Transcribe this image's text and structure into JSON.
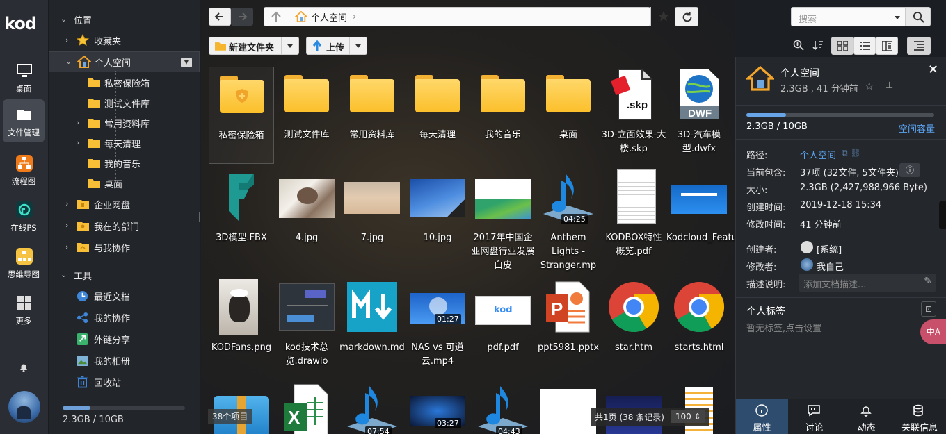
{
  "app": {
    "logo": "kod",
    "apps": [
      {
        "label": "桌面",
        "icon": "monitor-icon"
      },
      {
        "label": "文件管理",
        "icon": "folder-manage-icon"
      },
      {
        "label": "流程图",
        "icon": "flowchart-icon"
      },
      {
        "label": "在线PS",
        "icon": "photoshop-icon"
      },
      {
        "label": "思维导图",
        "icon": "mindmap-icon"
      },
      {
        "label": "更多",
        "icon": "grid-icon"
      }
    ]
  },
  "sidebar": {
    "section_location": "位置",
    "favorites": "收藏夹",
    "personal_space": "个人空间",
    "subfolders": [
      "私密保险箱",
      "测试文件库",
      "常用资料库",
      "每天清理",
      "我的音乐",
      "桌面"
    ],
    "enterprise_disk": "企业网盘",
    "my_department": "我在的部门",
    "collab_with_me": "与我协作",
    "section_tools": "工具",
    "tools": [
      "最近文档",
      "我的协作",
      "外链分享",
      "我的相册",
      "回收站"
    ],
    "quota_text": "2.3GB / 10GB",
    "quota_used": 0.23
  },
  "toolbar": {
    "breadcrumb": "个人空间",
    "search_placeholder": "搜索",
    "new_folder": "新建文件夹",
    "upload": "上传"
  },
  "files": [
    {
      "name": "私密保险箱",
      "type": "safe"
    },
    {
      "name": "测试文件库",
      "type": "folder"
    },
    {
      "name": "常用资料库",
      "type": "folder"
    },
    {
      "name": "每天清理",
      "type": "folder"
    },
    {
      "name": "我的音乐",
      "type": "folder"
    },
    {
      "name": "桌面",
      "type": "folder"
    },
    {
      "name": "3D-立面效果-大楼.skp",
      "type": "skp"
    },
    {
      "name": "3D-汽车模型.dwfx",
      "type": "dwf"
    },
    {
      "name": "3D模型.FBX",
      "type": "fbx"
    },
    {
      "name": "4.jpg",
      "type": "img-cat"
    },
    {
      "name": "7.jpg",
      "type": "img-beach"
    },
    {
      "name": "10.jpg",
      "type": "img-sky"
    },
    {
      "name": "2017年中国企业网盘行业发展白皮",
      "type": "img-report"
    },
    {
      "name": "Anthem Lights - Stranger.mp",
      "type": "music",
      "duration": "04:25"
    },
    {
      "name": "KODBOX特性概览.pdf",
      "type": "doc"
    },
    {
      "name": "Kodcloud_FeaturesOverview_en.pdf",
      "type": "img-web"
    },
    {
      "name": "KODFans.png",
      "type": "img-person"
    },
    {
      "name": "kod技术总览.drawio",
      "type": "img-drawio"
    },
    {
      "name": "markdown.md",
      "type": "md"
    },
    {
      "name": "NAS vs 可道云.mp4",
      "type": "video",
      "duration": "01:27"
    },
    {
      "name": "pdf.pdf",
      "type": "img-kod"
    },
    {
      "name": "ppt5981.pptx",
      "type": "ppt"
    },
    {
      "name": "star.htm",
      "type": "chrome"
    },
    {
      "name": "starts.html",
      "type": "chrome"
    },
    {
      "name": "",
      "type": "zip"
    },
    {
      "name": "",
      "type": "excel"
    },
    {
      "name": "",
      "type": "music",
      "duration": "07:54"
    },
    {
      "name": "",
      "type": "video2",
      "duration": "03:27"
    },
    {
      "name": "",
      "type": "music",
      "duration": "04:43"
    },
    {
      "name": "",
      "type": "img-white"
    },
    {
      "name": "",
      "type": "img-dark"
    },
    {
      "name": "",
      "type": "img-list"
    }
  ],
  "status": {
    "item_count": "38个项目",
    "pagination": "共1页 (38 条记录)",
    "per_page": "100"
  },
  "panel": {
    "title": "个人空间",
    "subtitle": "2.3GB , 41 分钟前",
    "usage": "2.3GB / 10GB",
    "usage_link": "空间容量",
    "usage_fraction": 0.21,
    "rows": [
      {
        "k": "路径:",
        "v": "个人空间"
      },
      {
        "k": "当前包含:",
        "v": "37项 (32文件, 5文件夹)"
      },
      {
        "k": "大小:",
        "v": "2.3GB (2,427,988,966 Byte)"
      },
      {
        "k": "创建时间:",
        "v": "2019-12-18 15:34"
      },
      {
        "k": "修改时间:",
        "v": "41 分钟前"
      },
      {
        "k": "创建者:",
        "v": "[系统]"
      },
      {
        "k": "修改者:",
        "v": "我自己"
      },
      {
        "k": "描述说明:",
        "v": "添加文档描述..."
      }
    ],
    "tags_title": "个人标签",
    "tags_empty": "暂无标签,点击设置",
    "tabs": [
      "属性",
      "讨论",
      "动态",
      "关联信息"
    ],
    "floating": "中A"
  }
}
